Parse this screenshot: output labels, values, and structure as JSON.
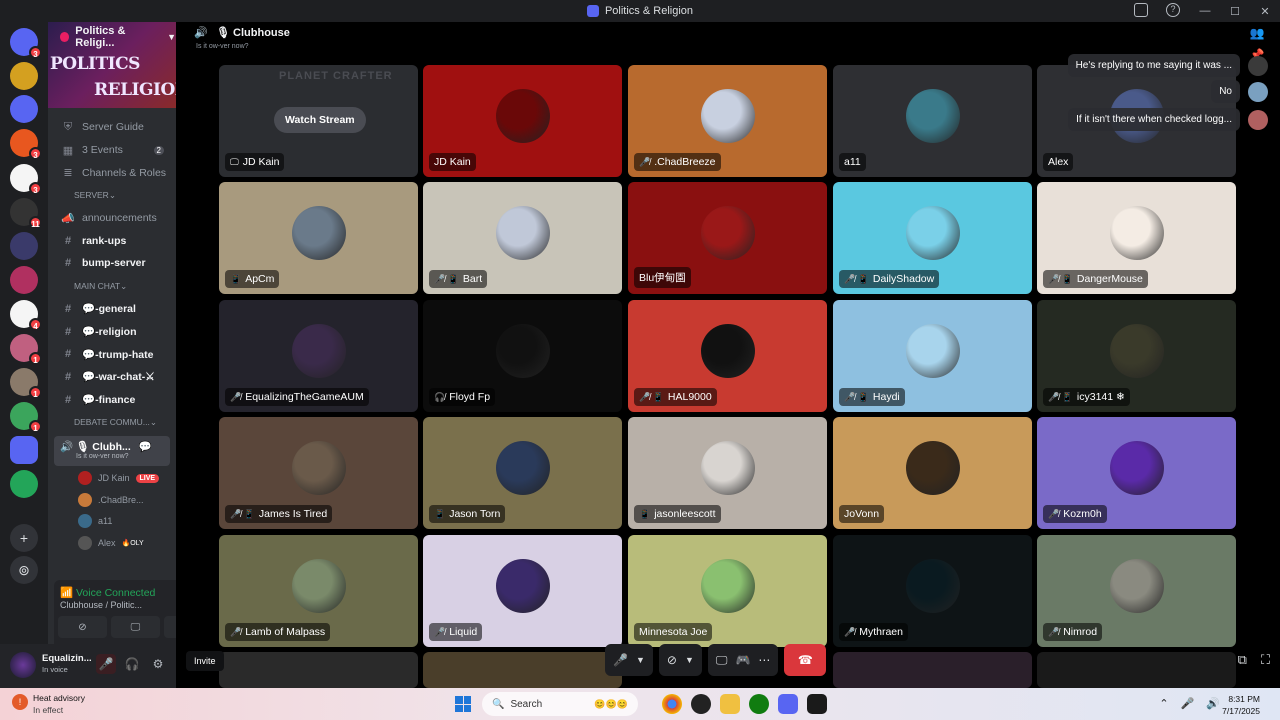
{
  "window": {
    "title": "Politics & Religion"
  },
  "guilds": [
    {
      "badge": "3",
      "color": "#5865f2"
    },
    {
      "badge": "",
      "color": "#d4a020"
    },
    {
      "badge": "",
      "color": "#5865f2"
    },
    {
      "badge": "3",
      "color": "#e8571f"
    },
    {
      "badge": "3",
      "color": "#f5f5f5"
    },
    {
      "badge": "11",
      "color": "#333333"
    },
    {
      "badge": "",
      "color": "#3a3a6a"
    },
    {
      "badge": "",
      "color": "#b03060"
    },
    {
      "badge": "4",
      "color": "#f5f5f5"
    },
    {
      "badge": "1",
      "color": "#c06080"
    },
    {
      "badge": "1",
      "color": "#8a7a6a"
    },
    {
      "badge": "1",
      "color": "#3ba55c"
    },
    {
      "badge": "",
      "color": "#5865f2"
    },
    {
      "badge": "",
      "color": "#23a559"
    }
  ],
  "server": {
    "name": "Politics & Religi...",
    "banner_line1": "POLITICS",
    "banner_line2": "RELIGION",
    "menu": [
      {
        "icon": "⛨",
        "label": "Server Guide",
        "count": ""
      },
      {
        "icon": "▦",
        "label": "3 Events",
        "count": "2"
      },
      {
        "icon": "≣",
        "label": "Channels & Roles",
        "count": ""
      }
    ],
    "cat_server": "SERVER",
    "server_channels": [
      "announcements",
      "rank-ups",
      "bump-server"
    ],
    "cat_main": "MAIN CHAT",
    "main_channels": [
      "💬-general",
      "💬-religion",
      "💬-trump-hate",
      "💬-war-chat-⚔",
      "💬-finance"
    ],
    "cat_debate": "DEBATE COMMU...",
    "voice_channel": {
      "name": "🎙 Clubh...",
      "status": "Is it ow-ver now?"
    },
    "voice_users": [
      {
        "name": "JD Kain",
        "tag": "LIVE",
        "color": "#b02020"
      },
      {
        "name": ".ChadBre...",
        "tag": "",
        "color": "#c87a3a"
      },
      {
        "name": "a11",
        "tag": "",
        "color": "#3a6a8a"
      },
      {
        "name": "Alex",
        "tag": "🔥OLY",
        "color": "#555"
      }
    ]
  },
  "voice_panel": {
    "status": "Voice Connected",
    "channel": "Clubhouse / Politic...",
    "user": "Equalizin...",
    "user_status": "In voice"
  },
  "stage": {
    "title": "Clubhouse",
    "status": "Is it ow-ver now?",
    "watch_label": "Watch Stream",
    "ghost_text": "PLANET CRAFTER",
    "invite_label": "Invite"
  },
  "tiles": [
    {
      "name": "JD Kain",
      "bg": "#2b2d31",
      "avatar": "",
      "icon": "🖵",
      "stream": true
    },
    {
      "name": "JD Kain",
      "bg": "#a01010",
      "avatar": "#6a0808",
      "icon": ""
    },
    {
      "name": ".ChadBreeze",
      "bg": "#b86a2e",
      "avatar": "#c8d0e0",
      "icon": "🎤̸"
    },
    {
      "name": "a11",
      "bg": "#2e2f33",
      "avatar": "#3a7a8a",
      "icon": ""
    },
    {
      "name": "Alex",
      "bg": "#2e2f33",
      "avatar": "#4a5a8a",
      "icon": ""
    },
    {
      "name": "ApCm",
      "bg": "#a89a7e",
      "avatar": "#6a7a8a",
      "icon": "📱"
    },
    {
      "name": "Bart",
      "bg": "#c8c4b8",
      "avatar": "#c0c8d8",
      "icon": "🎤̸ 📱"
    },
    {
      "name": "Blu伊甸園",
      "bg": "#8a1010",
      "avatar": "#9a1818",
      "icon": ""
    },
    {
      "name": "DailyShadow",
      "bg": "#5ac8e0",
      "avatar": "#7ad0e8",
      "icon": "🎤̸ 📱"
    },
    {
      "name": "DangerMouse",
      "bg": "#e8e0d8",
      "avatar": "#f4ece4",
      "icon": "🎤̸ 📱"
    },
    {
      "name": "EqualizingTheGameAUM",
      "bg": "#24232c",
      "avatar": "#3a2a4a",
      "icon": "🎤̸"
    },
    {
      "name": "Floyd Fp",
      "bg": "#0c0c0c",
      "avatar": "#111",
      "icon": "🎧̸"
    },
    {
      "name": "HAL9000",
      "bg": "#c83a30",
      "avatar": "#111",
      "icon": "🎤̸ 📱"
    },
    {
      "name": "Haydi",
      "bg": "#8ec0e0",
      "avatar": "#a8d4ec",
      "icon": "🎤̸ 📱"
    },
    {
      "name": "icy3141 ❄",
      "bg": "#252a22",
      "avatar": "#3a3a2a",
      "icon": "🎤̸ 📱"
    },
    {
      "name": "James Is Tired",
      "bg": "#5a463a",
      "avatar": "#6a5a4a",
      "icon": "🎤̸ 📱"
    },
    {
      "name": "Jason Torn",
      "bg": "#7a704c",
      "avatar": "#2a3a5a",
      "icon": "📱"
    },
    {
      "name": "jasonleescott",
      "bg": "#b8b0a8",
      "avatar": "#d8d4d0",
      "icon": "📱"
    },
    {
      "name": "JoVonn",
      "bg": "#c89a5a",
      "avatar": "#3a2a1a",
      "icon": ""
    },
    {
      "name": "Kozm0h",
      "bg": "#7a6ac8",
      "avatar": "#5a2aa8",
      "icon": "🎤̸"
    },
    {
      "name": "Lamb of Malpass",
      "bg": "#6a6a4a",
      "avatar": "#7a8a6a",
      "icon": "🎤̸"
    },
    {
      "name": "Liquid",
      "bg": "#d8d0e4",
      "avatar": "#3a2a6a",
      "icon": "🎤̸"
    },
    {
      "name": "Minnesota Joe",
      "bg": "#b8bc7a",
      "avatar": "#8ac070",
      "icon": ""
    },
    {
      "name": "Mythraen",
      "bg": "#0e1416",
      "avatar": "#0a1a20",
      "icon": "🎤̸"
    },
    {
      "name": "Nimrod",
      "bg": "#6a7a66",
      "avatar": "#8a8a80",
      "icon": "🎤̸"
    }
  ],
  "chat_bubbles": [
    {
      "text": "He's replying to me saying it was ...",
      "color": "#3a3a3a"
    },
    {
      "text": "No",
      "color": "#7aa0c0"
    },
    {
      "text": "If it isn't there when checked logg...",
      "color": "#b06060"
    }
  ],
  "taskbar": {
    "weather_title": "Heat advisory",
    "weather_sub": "In effect",
    "search_placeholder": "Search",
    "time": "8:31 PM",
    "date": "7/17/2025"
  }
}
